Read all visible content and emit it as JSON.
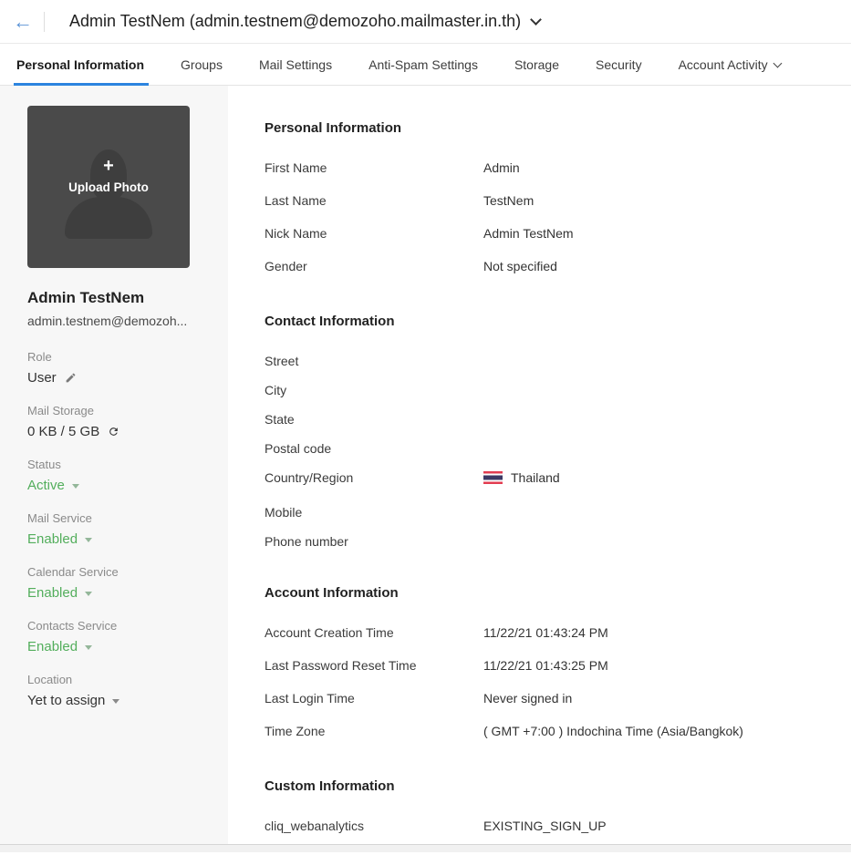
{
  "header": {
    "title": "Admin TestNem (admin.testnem@demozoho.mailmaster.in.th)"
  },
  "tabs": [
    {
      "label": "Personal Information",
      "active": true,
      "has_dropdown": false
    },
    {
      "label": "Groups",
      "active": false,
      "has_dropdown": false
    },
    {
      "label": "Mail Settings",
      "active": false,
      "has_dropdown": false
    },
    {
      "label": "Anti-Spam Settings",
      "active": false,
      "has_dropdown": false
    },
    {
      "label": "Storage",
      "active": false,
      "has_dropdown": false
    },
    {
      "label": "Security",
      "active": false,
      "has_dropdown": false
    },
    {
      "label": "Account Activity",
      "active": false,
      "has_dropdown": true
    }
  ],
  "sidebar": {
    "upload_plus": "+",
    "upload_photo_label": "Upload Photo",
    "name": "Admin TestNem",
    "email": "admin.testnem@demozoh...",
    "fields": [
      {
        "label": "Role",
        "value": "User",
        "green": false,
        "icon": "edit",
        "dropdown": false
      },
      {
        "label": "Mail Storage",
        "value": "0 KB / 5 GB",
        "green": false,
        "icon": "refresh",
        "dropdown": false
      },
      {
        "label": "Status",
        "value": "Active",
        "green": true,
        "icon": null,
        "dropdown": true
      },
      {
        "label": "Mail Service",
        "value": "Enabled",
        "green": true,
        "icon": null,
        "dropdown": true
      },
      {
        "label": "Calendar Service",
        "value": "Enabled",
        "green": true,
        "icon": null,
        "dropdown": true
      },
      {
        "label": "Contacts Service",
        "value": "Enabled",
        "green": true,
        "icon": null,
        "dropdown": true
      },
      {
        "label": "Location",
        "value": "Yet to assign",
        "green": false,
        "icon": null,
        "dropdown": true,
        "gray_caret": true
      }
    ]
  },
  "sections": [
    {
      "title": "Personal Information",
      "compact": false,
      "rows": [
        {
          "label": "First Name",
          "value": "Admin"
        },
        {
          "label": "Last Name",
          "value": "TestNem"
        },
        {
          "label": "Nick Name",
          "value": "Admin TestNem"
        },
        {
          "label": "Gender",
          "value": "Not specified"
        }
      ]
    },
    {
      "title": "Contact Information",
      "compact": true,
      "rows": [
        {
          "label": "Street",
          "value": ""
        },
        {
          "label": "City",
          "value": ""
        },
        {
          "label": "State",
          "value": ""
        },
        {
          "label": "Postal code",
          "value": ""
        },
        {
          "label": "Country/Region",
          "value": "Thailand",
          "flag": "thailand"
        },
        {
          "label": "Mobile",
          "value": ""
        },
        {
          "label": "Phone number",
          "value": ""
        }
      ]
    },
    {
      "title": "Account Information",
      "compact": false,
      "rows": [
        {
          "label": "Account Creation Time",
          "value": "11/22/21 01:43:24 PM"
        },
        {
          "label": "Last Password Reset Time",
          "value": "11/22/21 01:43:25 PM"
        },
        {
          "label": "Last Login Time",
          "value": "Never signed in"
        },
        {
          "label": "Time Zone",
          "value": "( GMT +7:00 ) Indochina Time (Asia/Bangkok)"
        }
      ]
    },
    {
      "title": "Custom Information",
      "compact": false,
      "rows": [
        {
          "label": "cliq_webanalytics",
          "value": "EXISTING_SIGN_UP"
        }
      ]
    }
  ],
  "colors": {
    "accent_blue": "#2c84df",
    "back_arrow_blue": "#5b93d6",
    "green": "#53ae5c",
    "sidebar_bg": "#f7f7f7",
    "thai_flag_red": "#e23d51",
    "thai_flag_navy": "#3d3a65"
  }
}
